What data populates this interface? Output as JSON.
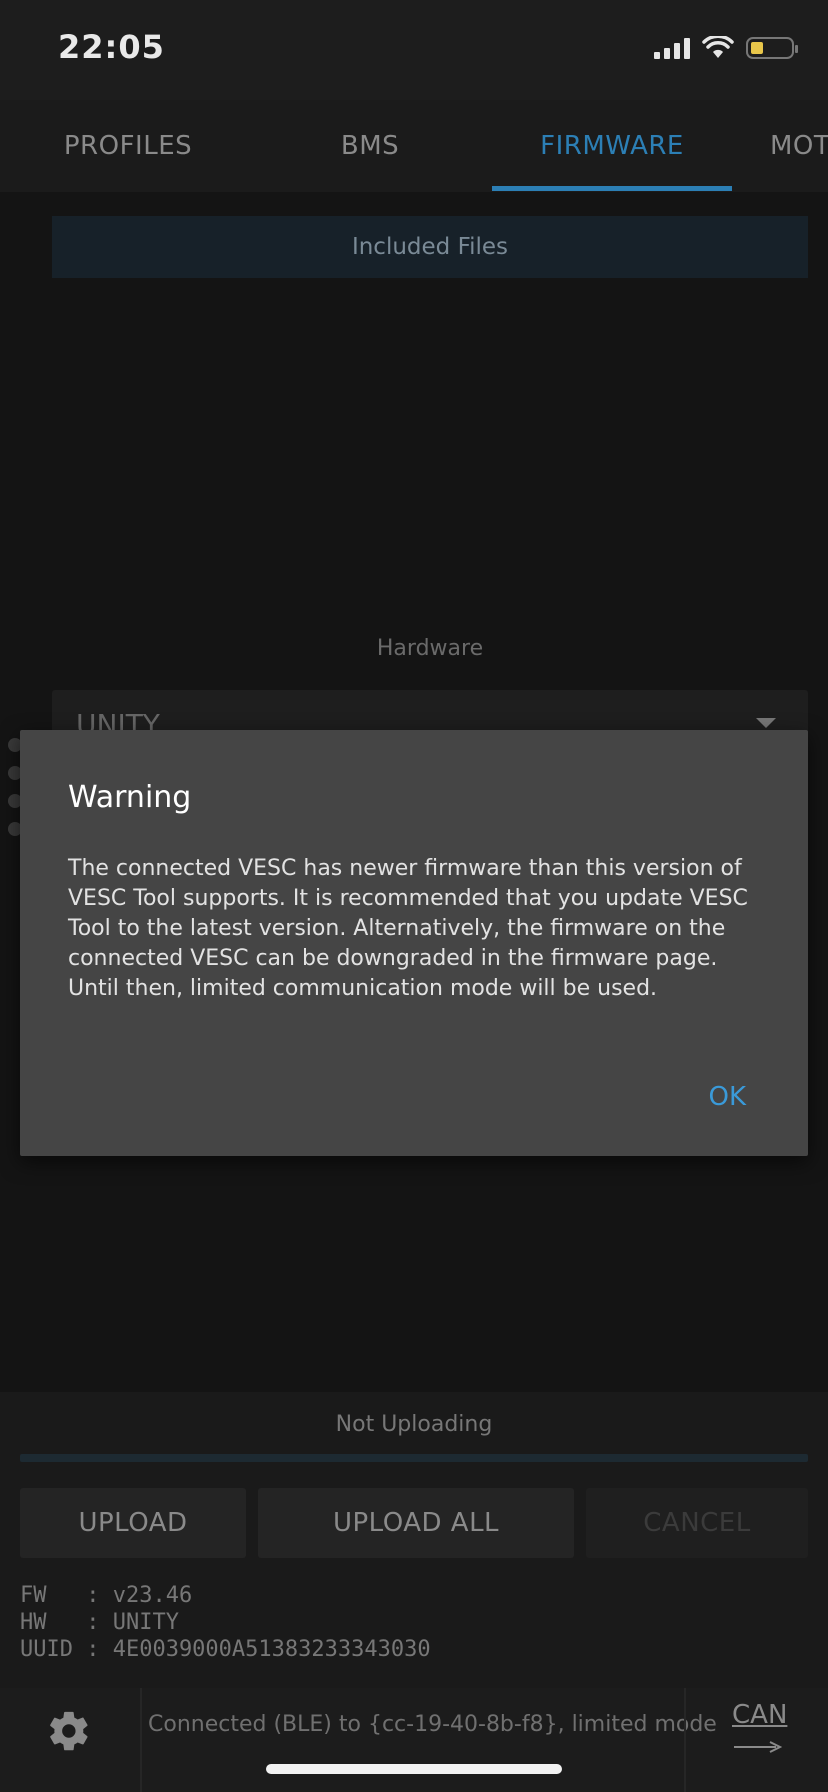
{
  "status": {
    "time": "22:05",
    "battery_color": "#e8c64a"
  },
  "tabs": [
    {
      "label": "PROFILES",
      "active": false
    },
    {
      "label": "BMS",
      "active": false
    },
    {
      "label": "FIRMWARE",
      "active": true
    },
    {
      "label": "MOT",
      "active": false
    }
  ],
  "firmware": {
    "included_files_label": "Included Files",
    "hardware_label": "Hardware",
    "hardware_value": "UNITY"
  },
  "dialog": {
    "title": "Warning",
    "message": "The connected VESC has newer firmware than this version of VESC Tool supports. It is recommended that you update VESC Tool to the latest version. Alternatively, the firmware on the connected VESC can be downgraded in the firmware page. Until then, limited communication mode will be used.",
    "ok_label": "OK"
  },
  "upload": {
    "status": "Not Uploading",
    "upload_label": "UPLOAD",
    "upload_all_label": "UPLOAD ALL",
    "cancel_label": "CANCEL",
    "progress": 0
  },
  "info": {
    "fw_line": "FW   : v23.46",
    "hw_line": "HW   : UNITY",
    "uuid_line": "UUID : 4E0039000A51383233343030"
  },
  "bottom": {
    "connection": "Connected (BLE) to {cc-19-40-8b-f8}, limited mode",
    "can_label": "CAN"
  },
  "colors": {
    "accent": "#2c7fb5",
    "dialog_bg": "#454545",
    "ok": "#3a9ad9"
  }
}
